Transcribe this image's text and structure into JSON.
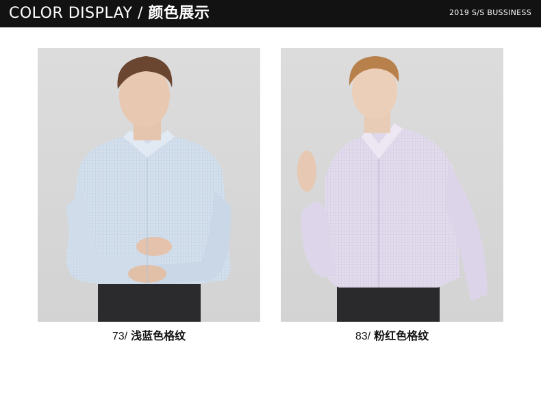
{
  "header": {
    "title_en": "COLOR DISPLAY /",
    "title_cn": "颜色展示",
    "season": "2019 S/S BUSSINESS"
  },
  "products": [
    {
      "code": "73/",
      "name": "浅蓝色格纹",
      "shirt_color": "#cfdcea"
    },
    {
      "code": "83/",
      "name": "粉红色格纹",
      "shirt_color": "#e3ddee"
    }
  ]
}
